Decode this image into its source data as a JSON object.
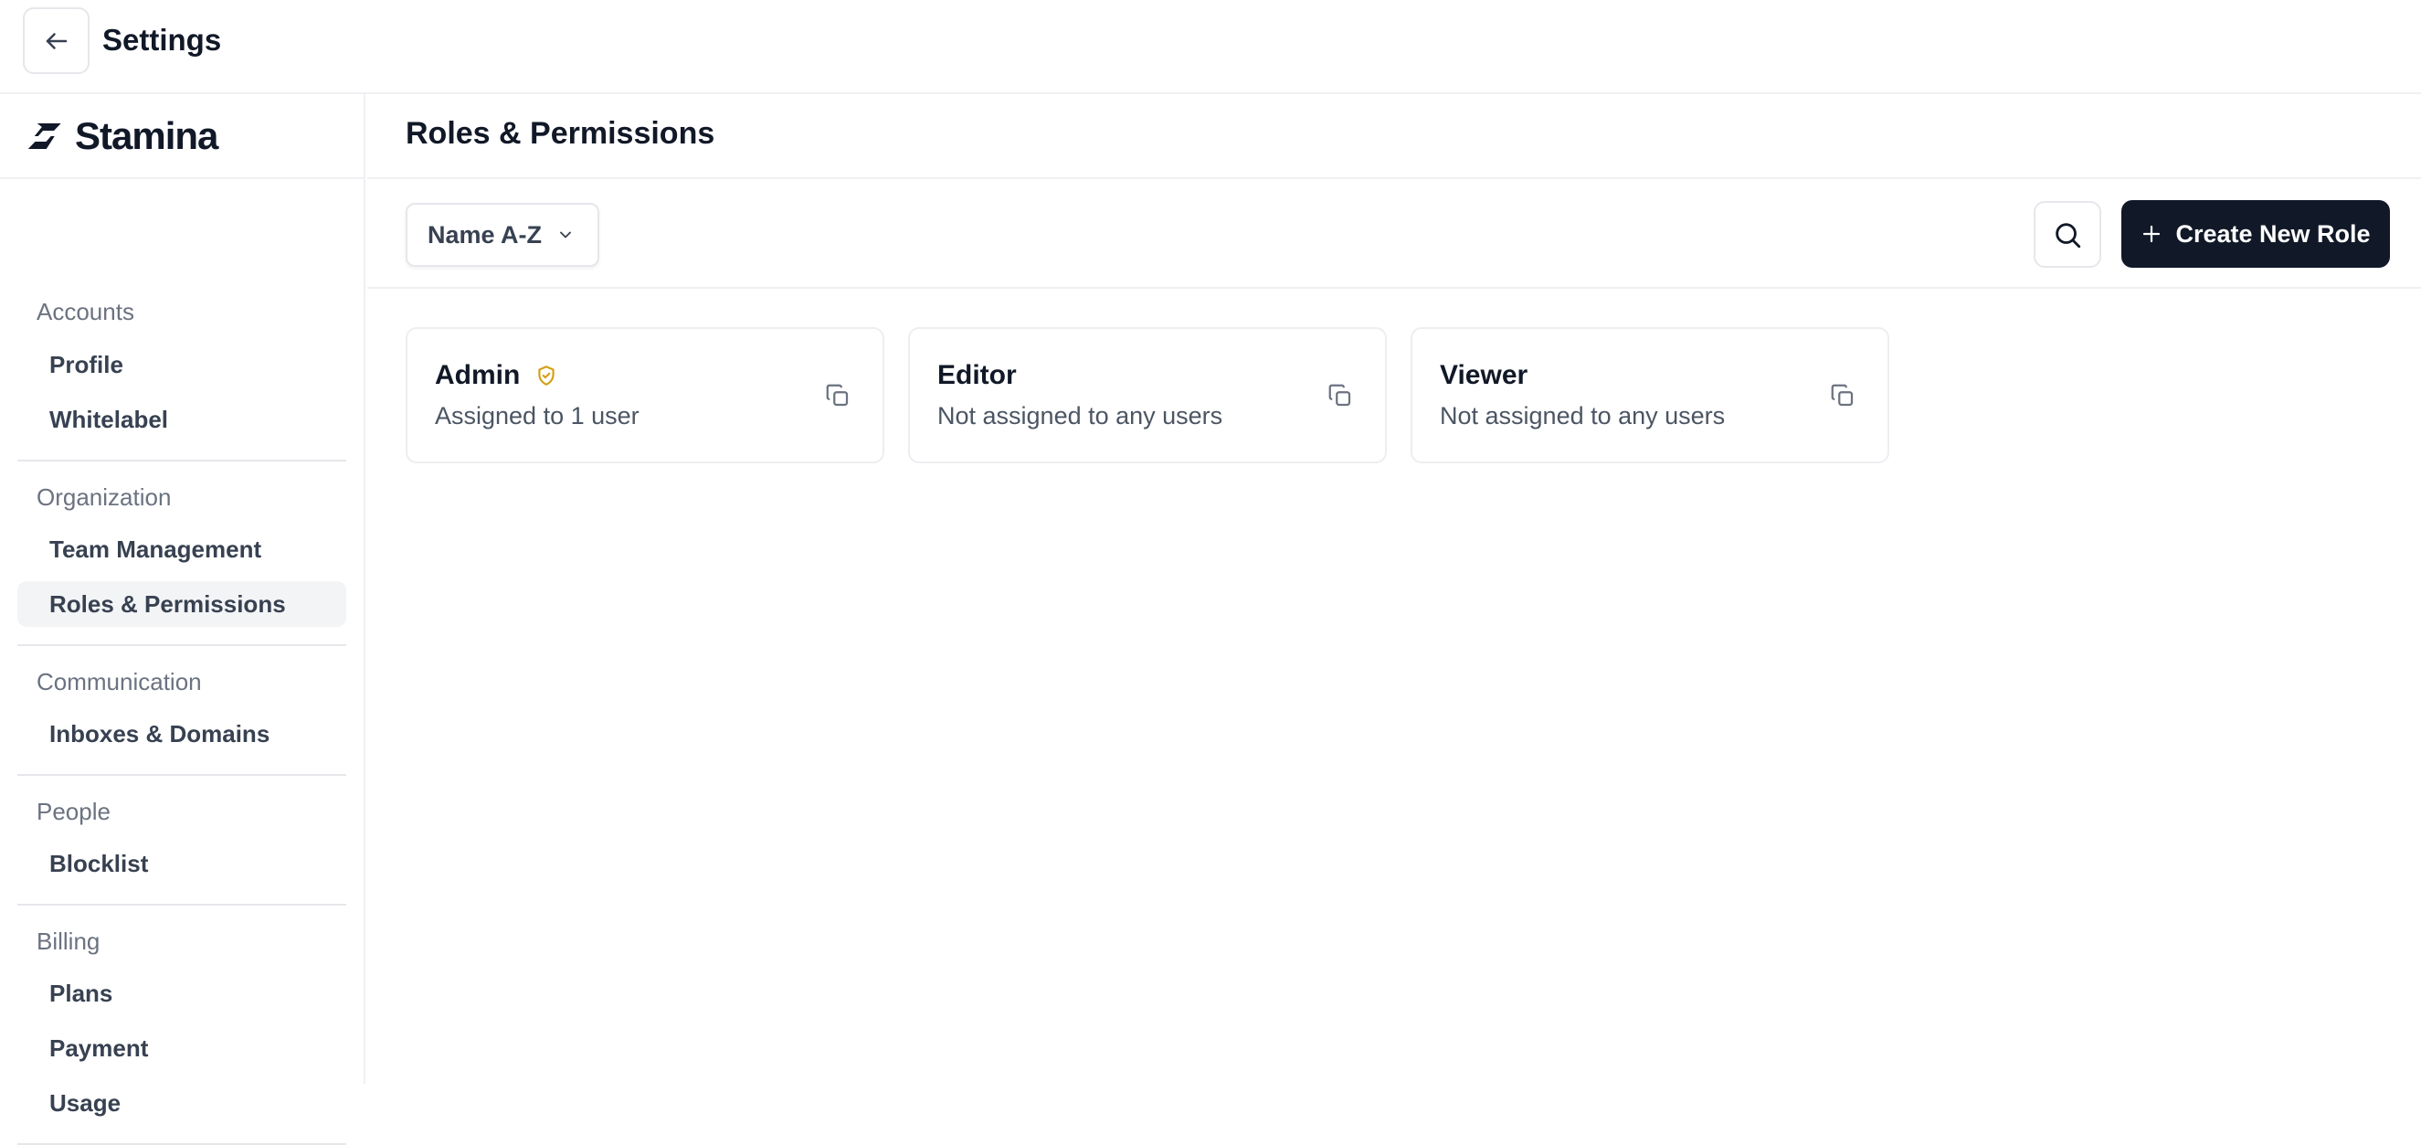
{
  "topbar": {
    "title": "Settings",
    "back_icon": "arrow-left-icon"
  },
  "brand": {
    "name": "Stamina",
    "logo_icon": "stamina-logo-icon"
  },
  "sidebar": {
    "sections": [
      {
        "label": "Accounts",
        "items": [
          "Profile",
          "Whitelabel"
        ]
      },
      {
        "label": "Organization",
        "items": [
          "Team Management",
          "Roles & Permissions"
        ]
      },
      {
        "label": "Communication",
        "items": [
          "Inboxes & Domains"
        ]
      },
      {
        "label": "People",
        "items": [
          "Blocklist"
        ]
      },
      {
        "label": "Billing",
        "items": [
          "Plans",
          "Payment",
          "Usage"
        ]
      }
    ],
    "active_item": "Roles & Permissions"
  },
  "main": {
    "title": "Roles & Permissions",
    "sort": {
      "value": "Name A-Z",
      "icon": "chevron-down-icon"
    },
    "search_icon": "search-icon",
    "create_button": {
      "label": "Create New Role",
      "icon": "plus-icon"
    }
  },
  "roles": [
    {
      "name": "Admin",
      "subtitle": "Assigned to 1 user",
      "badge_icon": "shield-check-icon",
      "badge_color": "#d4a017"
    },
    {
      "name": "Editor",
      "subtitle": "Not assigned to any users"
    },
    {
      "name": "Viewer",
      "subtitle": "Not assigned to any users"
    }
  ],
  "colors": {
    "primary_button": "#111827",
    "active_nav_bg": "#f3f4f6"
  }
}
